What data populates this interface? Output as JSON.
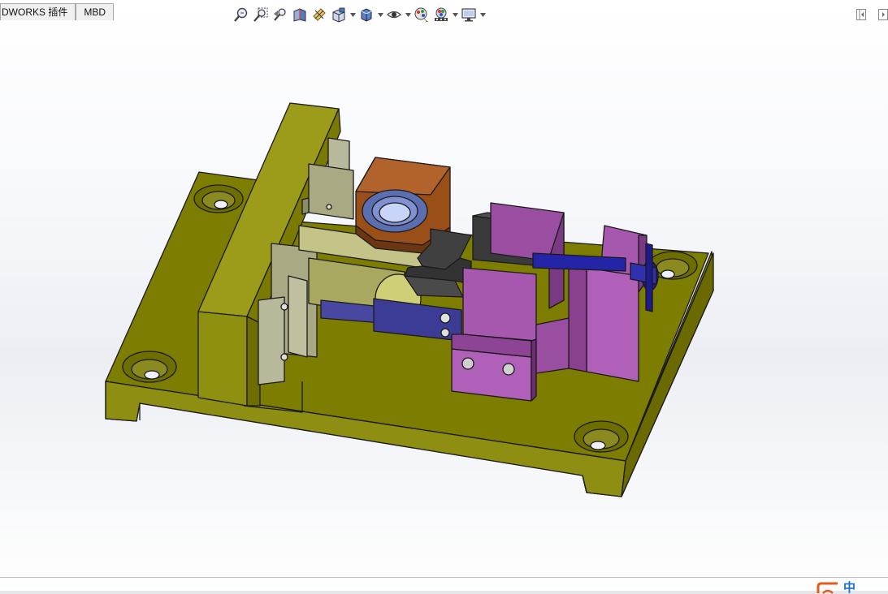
{
  "tabs": [
    {
      "label": "DWORKS 插件"
    },
    {
      "label": "MBD"
    }
  ],
  "view_toolbar": {
    "buttons": [
      "zoom-to-fit-icon",
      "zoom-to-area-icon",
      "previous-view-icon",
      "section-view-icon",
      "dynamic-annotation-views-icon",
      "view-orientation-icon",
      "display-style-icon",
      "hide-show-items-icon",
      "edit-appearance-icon",
      "apply-scene-icon",
      "view-settings-icon"
    ]
  },
  "ime": {
    "label": "中"
  },
  "colors": {
    "base_plate": "#7a7a00",
    "base_side": "#8c8c10",
    "wall": "#9a9a18",
    "slider_block": "#a8a882",
    "copper_clamp": "#8b4a1c",
    "bearing_blue": "#5b6fb0",
    "vise_purple": "#a050a8",
    "jaw_dark": "#3a3a3a",
    "blue_support": "#3c3c96",
    "screw_blue": "#2020a0"
  }
}
